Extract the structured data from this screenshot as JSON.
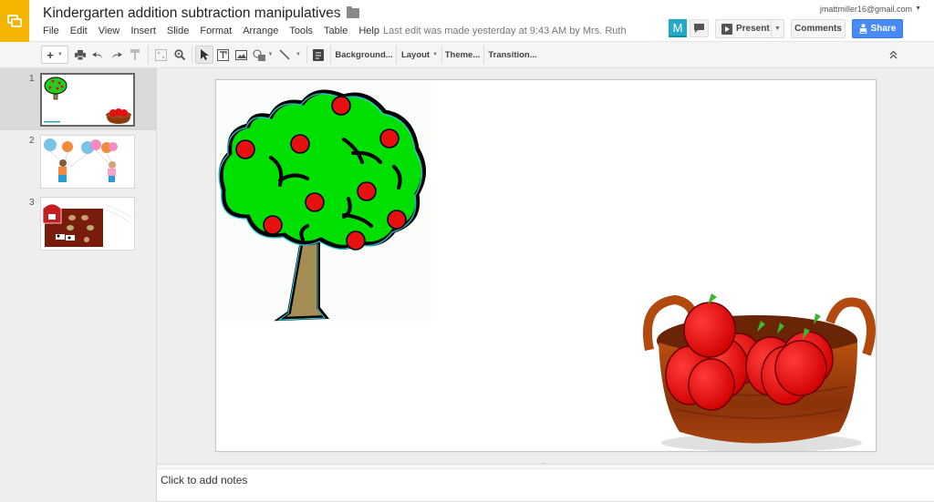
{
  "app": {
    "document_title": "Kindergarten addition subtraction manipulatives",
    "last_edit": "Last edit was made yesterday at 9:43 AM by Mrs. Ruth",
    "account_email": "jmattmiller16@gmail.com",
    "brand_color": "#f4b400"
  },
  "menu": [
    "File",
    "Edit",
    "View",
    "Insert",
    "Slide",
    "Format",
    "Arrange",
    "Tools",
    "Table",
    "Help"
  ],
  "header_buttons": {
    "avatar_letter": "M",
    "present_label": "Present",
    "comments_label": "Comments",
    "share_label": "Share",
    "share_color": "#4a8af4"
  },
  "toolbar": {
    "background_label": "Background...",
    "layout_label": "Layout",
    "theme_label": "Theme...",
    "transition_label": "Transition..."
  },
  "slides": [
    {
      "number": "1",
      "description": "Apple tree and basket of apples",
      "selected": true
    },
    {
      "number": "2",
      "description": "Two children holding balloons",
      "selected": false
    },
    {
      "number": "3",
      "description": "Barn with farm animals",
      "selected": false
    }
  ],
  "current_slide": {
    "images": [
      "apple-tree",
      "apple-basket"
    ]
  },
  "notes": {
    "placeholder": "Click to add notes"
  }
}
